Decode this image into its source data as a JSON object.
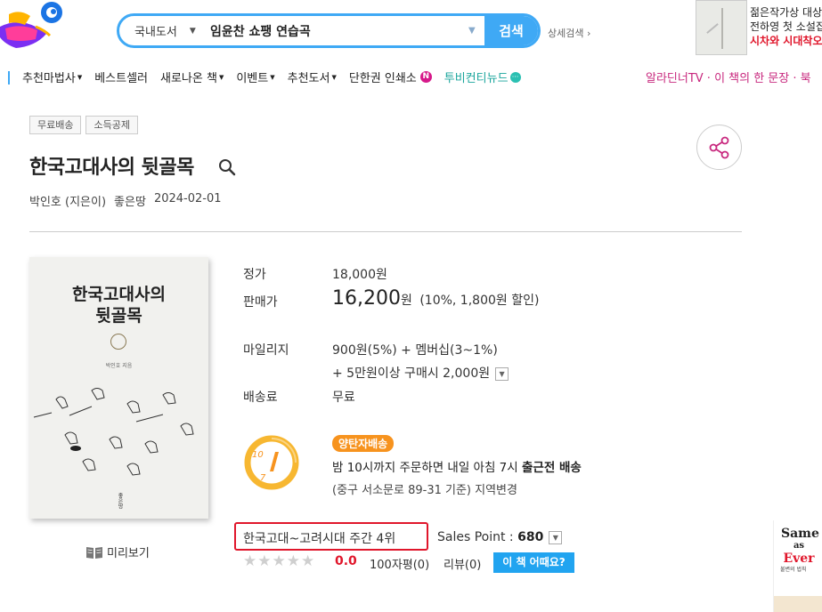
{
  "header": {
    "search": {
      "category": "국내도서",
      "query": "임윤찬 쇼팽 연습곡",
      "button_label": "검색",
      "advanced_label": "상세검색"
    },
    "ad": {
      "line1": "젊은작가상 대상,",
      "line2": "전하영 첫 소설집",
      "line3": "시차와 시대착오"
    }
  },
  "nav": {
    "items": [
      {
        "label": "추천마법사"
      },
      {
        "label": "베스트셀러"
      },
      {
        "label": "새로나온 책"
      },
      {
        "label": "이벤트"
      },
      {
        "label": "추천도서"
      },
      {
        "label": "단한권 인쇄소"
      },
      {
        "label": "투비컨티뉴드"
      }
    ],
    "right_text": "알라딘너TV · 이 책의 한 문장 · 북"
  },
  "book": {
    "tags": [
      "무료배송",
      "소득공제"
    ],
    "title": "한국고대사의 뒷골목",
    "author": "박인호 (지은이)",
    "publisher": "좋은땅",
    "date": "2024-02-01",
    "cover": {
      "title_line1": "한국고대사의",
      "title_line2": "뒷골목",
      "author": "박인호 지음",
      "publisher": "좋은땅"
    },
    "preview_label": "미리보기"
  },
  "price": {
    "list_label": "정가",
    "list_price": "18,000원",
    "sale_label": "판매가",
    "sale_price": "16,200",
    "sale_unit": "원",
    "discount": "(10%, 1,800원 할인)",
    "mileage_label": "마일리지",
    "mileage_line1": "900원(5%) + 멤버십(3~1%)",
    "mileage_line2": "+ 5만원이상 구매시 2,000원",
    "shipping_label": "배송료",
    "shipping_value": "무료"
  },
  "delivery": {
    "tag": "양탄자배송",
    "line1_pre": "밤 10시까지 주문하면 내일 아침 7시 ",
    "line1_bold": "출근전 배송",
    "line2": "(중구 서소문로 89-31 기준) 지역변경",
    "icon_hour": "10",
    "icon_min": "7"
  },
  "rank": {
    "text": "한국고대~고려시대 주간 4위",
    "sales_point_label": "Sales Point : ",
    "sales_point_value": "680"
  },
  "rating": {
    "stars": 0,
    "score": "0.0",
    "short_reviews": "100자평(0)",
    "reviews": "리뷰(0)",
    "question_btn": "이 책 어때요?"
  },
  "side_ad": {
    "title_line1": "Same",
    "title_line2": "as",
    "title_line3": "Ever",
    "subtitle": "불변의 법칙"
  }
}
